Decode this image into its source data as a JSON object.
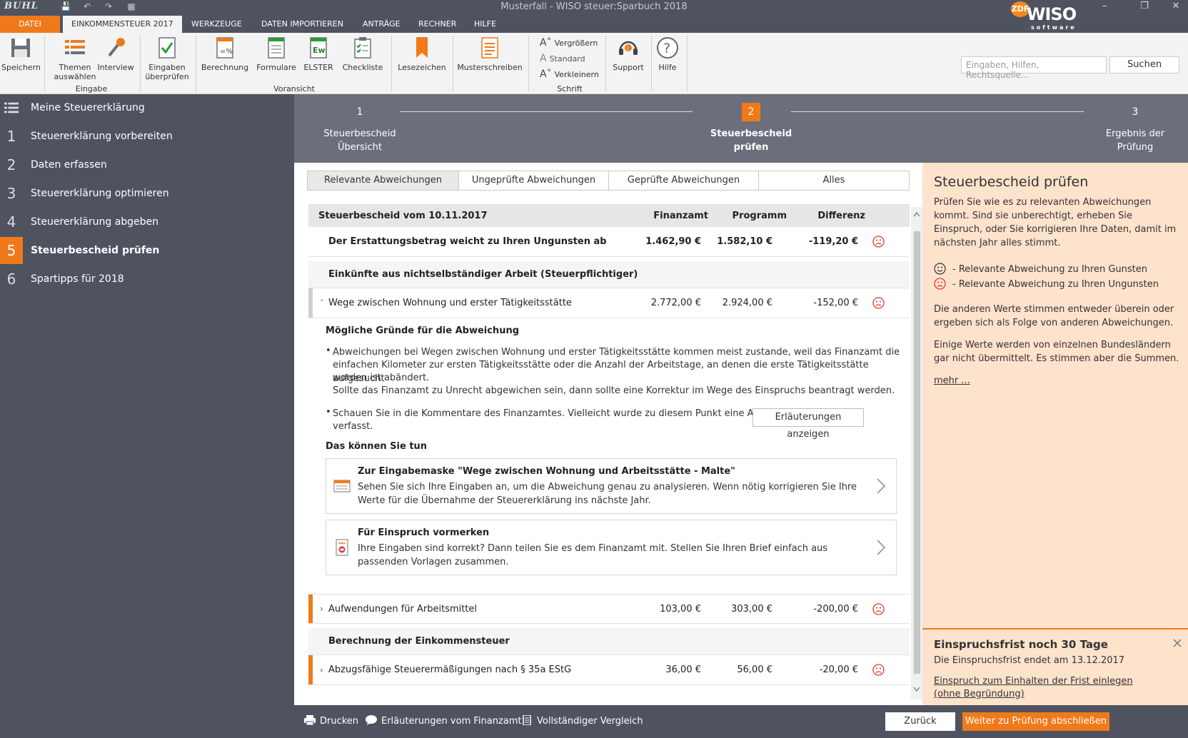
{
  "window": {
    "title": "Musterfall - WISO steuer:Sparbuch 2018",
    "logo_text": "BUHL",
    "brand": {
      "name": "WISO",
      "sub": "software",
      "badge": "ZDF"
    }
  },
  "menu_tabs": [
    "DATEI",
    "EINKOMMENSTEUER 2017",
    "WERKZEUGE",
    "DATEN IMPORTIEREN",
    "ANTRÄGE",
    "RECHNER",
    "HILFE"
  ],
  "ribbon": {
    "buttons": {
      "save": "Speichern",
      "topics": "Themen\nauswählen",
      "interview": "Interview",
      "check": "Eingaben\nüberprüfen",
      "calc": "Berechnung",
      "forms": "Formulare",
      "elster": "ELSTER",
      "checklist": "Checkliste",
      "bookmark": "Lesezeichen",
      "templates": "Musterschreiben",
      "support": "Support",
      "help": "Hilfe"
    },
    "groups": {
      "input": "Eingabe",
      "preview": "Voransicht",
      "font": "Schrift"
    },
    "font": {
      "bigger": "Vergrößern",
      "standard": "Standard",
      "smaller": "Verkleinern"
    },
    "search": {
      "placeholder": "Eingaben, Hilfen, Rechtsquelle...",
      "button": "Suchen"
    }
  },
  "sidebar": {
    "header": "Meine Steuererklärung",
    "items": [
      {
        "num": "1",
        "label": "Steuererklärung vorbereiten"
      },
      {
        "num": "2",
        "label": "Daten erfassen"
      },
      {
        "num": "3",
        "label": "Steuererklärung optimieren"
      },
      {
        "num": "4",
        "label": "Steuererklärung abgeben"
      },
      {
        "num": "5",
        "label": "Steuerbescheid prüfen"
      },
      {
        "num": "6",
        "label": "Spartipps für 2018"
      }
    ]
  },
  "stepper": [
    {
      "num": "1",
      "label": "Steuerbescheid\nÜbersicht"
    },
    {
      "num": "2",
      "label": "Steuerbescheid\nprüfen"
    },
    {
      "num": "3",
      "label": "Ergebnis der\nPrüfung"
    }
  ],
  "filters": [
    "Relevante Abweichungen",
    "Ungeprüfte Abweichungen",
    "Geprüfte Abweichungen",
    "Alles"
  ],
  "table": {
    "title": "Steuerbescheid vom 10.11.2017",
    "columns": [
      "Finanzamt",
      "Programm",
      "Differenz"
    ],
    "summary": {
      "label": "Der Erstattungsbetrag weicht zu Ihren Ungunsten ab",
      "fa": "1.462,90 €",
      "prog": "1.582,10 €",
      "diff": "-119,20 €"
    },
    "section1": "Einkünfte aus nichtselbständiger Arbeit (Steuerpflichtiger)",
    "row_wege": {
      "label": "Wege zwischen Wohnung und erster Tätigkeitsstätte",
      "fa": "2.772,00 €",
      "prog": "2.924,00 €",
      "diff": "-152,00 €"
    },
    "row_arbeitsmittel": {
      "label": "Aufwendungen für Arbeitsmittel",
      "fa": "103,00 €",
      "prog": "303,00 €",
      "diff": "-200,00 €"
    },
    "section2": "Berechnung der Einkommensteuer",
    "row_35a": {
      "label": "Abzugsfähige Steuerermäßigungen nach § 35a EStG",
      "fa": "36,00 €",
      "prog": "56,00 €",
      "diff": "-20,00 €"
    }
  },
  "detail": {
    "reasons_title": "Mögliche Gründe für die Abweichung",
    "reason1_l1": "Abweichungen bei Wegen zwischen Wohnung und erster Tätigkeitsstätte kommen meist zustande, weil das Finanzamt die",
    "reason1_l2": "einfachen Kilometer zur ersten Tätigkeitsstätte oder die Anzahl der Arbeitstage, an denen die erste Tätigkeitsstätte aufgesucht",
    "reason1_l3": "worden ist abändert.",
    "reason1_l4": "Sollte das Finanzamt zu Unrecht abgewichen sein, dann sollte eine Korrektur im Wege des Einspruchs beantragt werden.",
    "reason2_l1": "Schauen Sie in die Kommentare des Finanzamtes. Vielleicht wurde zu diesem Punkt eine Anmerkung",
    "reason2_l2": "verfasst.",
    "explain_button": "Erläuterungen anzeigen",
    "todo_title": "Das können Sie tun",
    "action1": {
      "title": "Zur Eingabemaske \"Wege zwischen Wohnung und Arbeitsstätte - Malte\"",
      "desc": "Sehen Sie sich Ihre Eingaben an, um die Abweichung genau zu analysieren. Wenn nötig korrigieren Sie Ihre Werte für die Übernahme der Steuererklärung ins nächste Jahr."
    },
    "action2": {
      "title": "Für Einspruch vormerken",
      "desc": "Ihre Eingaben sind korrekt? Dann teilen Sie es dem Finanzamt mit. Stellen Sie Ihren Brief einfach aus passenden Vorlagen zusammen."
    }
  },
  "right_panel": {
    "title": "Steuerbescheid prüfen",
    "intro": "Prüfen Sie wie es zu relevanten Abweichungen kommt. Sind sie unberechtigt, erheben Sie Einspruch, oder Sie korrigieren Ihre Daten, damit im nächsten Jahr alles stimmt.",
    "legend_good": "- Relevante Abweichung zu Ihren Gunsten",
    "legend_bad": "- Relevante Abweichung zu Ihren Ungunsten",
    "p2": "Die anderen Werte stimmen entweder überein oder ergeben sich als Folge von anderen Abweichungen.",
    "p3": "Einige Werte werden von einzelnen Bundesländern gar nicht übermittelt. Es stimmen aber die Summen.",
    "more": "mehr ...",
    "deadline_title": "Einspruchsfrist noch 30 Tage",
    "deadline_text": "Die Einspruchsfrist endet am 13.12.2017",
    "deadline_link": "Einspruch zum Einhalten der Frist einlegen (ohne Begründung)"
  },
  "bottombar": {
    "print": "Drucken",
    "explanations": "Erläuterungen vom Finanzamt",
    "compare": "Vollständiger Vergleich",
    "back": "Zurück",
    "next": "Weiter zu Prüfung abschließen"
  },
  "colors": {
    "accent": "#f07a1a",
    "dark": "#4f5360",
    "panel": "#fde2cc",
    "sad": "#e03c2c"
  }
}
